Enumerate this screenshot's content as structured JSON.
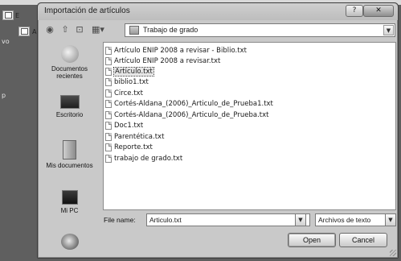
{
  "background": {
    "tab_letters": [
      "E",
      "A"
    ],
    "side_texts": [
      "vo",
      "p"
    ]
  },
  "dialog": {
    "title": "Importación de artículos",
    "help_label": "?",
    "close_label": "✕"
  },
  "toolbar": {
    "back_icon": "back-icon",
    "up_icon": "up-folder-icon",
    "new_folder_icon": "new-folder-icon",
    "views_icon": "views-menu-icon",
    "look_in_value": "Trabajo de grado"
  },
  "places": [
    {
      "label": "Documentos recientes",
      "icon": "recent-documents-icon"
    },
    {
      "label": "Escritorio",
      "icon": "desktop-icon"
    },
    {
      "label": "Mis documentos",
      "icon": "my-documents-icon"
    },
    {
      "label": "Mi PC",
      "icon": "my-computer-icon"
    },
    {
      "label": "",
      "icon": "network-icon"
    }
  ],
  "files": [
    {
      "name": "Artículo ENIP 2008 a revisar - Biblio.txt",
      "selected": false
    },
    {
      "name": "Artículo ENIP 2008 a revisar.txt",
      "selected": false
    },
    {
      "name": "Articulo.txt",
      "selected": true
    },
    {
      "name": "biblio1.txt",
      "selected": false
    },
    {
      "name": "Circe.txt",
      "selected": false
    },
    {
      "name": "Cortés-Aldana_(2006)_Articulo_de_Prueba1.txt",
      "selected": false
    },
    {
      "name": "Cortés-Aldana_(2006)_Articulo_de_Prueba.txt",
      "selected": false
    },
    {
      "name": "Doc1.txt",
      "selected": false
    },
    {
      "name": "Parentética.txt",
      "selected": false
    },
    {
      "name": "Reporte.txt",
      "selected": false
    },
    {
      "name": "trabajo de grado.txt",
      "selected": false
    }
  ],
  "bottom": {
    "file_name_label": "File name:",
    "file_name_value": "Articulo.txt",
    "file_type_value": "Archivos de texto",
    "open_label": "Open",
    "cancel_label": "Cancel"
  }
}
